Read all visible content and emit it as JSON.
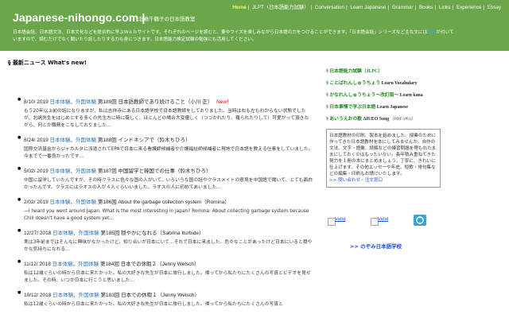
{
  "header": {
    "site_title": "Japanese-nihongo.com",
    "site_title_separator": "|",
    "tagline": "北嶋千鶴子の日本語教室",
    "nav": [
      {
        "label": "Home",
        "active": true
      },
      {
        "label": "JLPT（日本語能力試験）",
        "active": false
      },
      {
        "label": "Conversation",
        "active": false
      },
      {
        "label": "Learn Japanese",
        "active": false
      },
      {
        "label": "Grammar",
        "active": false
      },
      {
        "label": "Books",
        "active": false
      },
      {
        "label": "Links",
        "active": false
      },
      {
        "label": "Experience",
        "active": false
      },
      {
        "label": "Essay",
        "active": false
      }
    ],
    "intro_line1_prefix": "日本語会話、日本語文法、日本文化などを総合的に学ぶWｅｂサイトです。それぞれのページを読むと、要中ウイズを楽しみながら日本語の力をつけることができます。「日本語会話」シリーズなど主な文には",
    "intro_highlight": "読み",
    "intro_line1_suffix": "が付いて",
    "intro_line2": "いますので、読むだけでなく聞いたり話したりする力も身につきます。日本語能力検定試験の勉強にも活用してください。"
  },
  "news": {
    "heading": "§ 最新ニュース What's new!",
    "items": [
      {
        "date": "8/10/ 2019",
        "tag1": "日本体験",
        "tag2": "外国体験",
        "title": "第189回 日本語教師であり続けること（小川 正）",
        "new": "New！",
        "body": "もう20年以上前の話になりますが、私は吉祥寺にある日本語学校で日本語教師をしておりました。当時は右も左もわからない状態でしたが、北嶋先生をはじめとする多くの先生方に時に厳しく、ほとんどの場合大変優しく（つつかれたり、羅られたりして）可愛がって頂きながら、何とか職務をこなしておりました…"
      },
      {
        "date": "6/24/ 2019",
        "tag1": "日本体験",
        "tag2": "外国体験",
        "title": "第188回 インドネシアで（鈴木ちひろ）",
        "new": "",
        "body": "国際交流基金からジャカルタに派遣されてEPAで日本に来る看護師候補者や介護福祉師候補者に現地で日本語を教える仕事をしていました。今までで一番良かったです…"
      },
      {
        "date": "5/02/ 2019",
        "tag1": "日本体験",
        "tag2": "外国体験",
        "title": "第187回 中国留学と韓国での仕事（鈴木ちひろ）",
        "new": "",
        "body": "中国に留学していたんですが、その時クラスに色々な国の人がいて、いろいろな国の話やクラスメイトの意見を中国語で聞いて、とても面白かったんです。クラスにはラオスの人が４人ぐらいいました。ラオスの人に初めてあいました…"
      },
      {
        "date": "2/02/ 2019",
        "tag1": "日本体験",
        "tag2": "外国体験",
        "title": "第186回 About the garbage collection system（Romina）",
        "new": "",
        "body": "―I heard you went around Japan. What is the most interesting in Japan? Romina: About collecting garbage system because Chili doesn't have a good system yet…"
      },
      {
        "date": "12/27/ 2018",
        "tag1": "日本体験",
        "tag2": "外国体験",
        "title": "第185回 穏やかになれる（Sabrina Iturbide）",
        "new": "",
        "body": "実は3年前まではそんなに興味がなかったけど、知り合いが日本にいて…それで日本に来ました。色々なことがあったけど日本にいると穏やかな気持ちになれる…"
      },
      {
        "date": "11/12/ 2018",
        "tag1": "日本体験",
        "tag2": "外国体験",
        "title": "第184回 日本での休暇２（Jenny Welsch）",
        "new": "",
        "body": "私は12歳ぐらいの時から日本に来たかった。私の大好きな先生が日本に旅行しました。帰ってから私たちにたくさんの写真とビデオを見せました。その時、いつか日本に行こうと思いました…"
      },
      {
        "date": "10/12/ 2018",
        "tag1": "日本体験",
        "tag2": "外国体験",
        "title": "第183回 日本での休暇１（Jenny Welsch）",
        "new": "",
        "body": "私は12歳ぐらいの時から日本に来たかった。私の大好きな先生が日本に旅行しました。帰ってから私たちにたくさんの写真と"
      }
    ]
  },
  "sidebar": {
    "links": [
      {
        "jp": "§ 日本語能力試験（JLPC）",
        "en": "",
        "small": ""
      },
      {
        "jp": "§ ことばれんしゅうちょう",
        "en": "Learn Vocabulary",
        "small": ""
      },
      {
        "jp": "§ かなれんしゅうちょう～改訂版～",
        "en": "Learn kana",
        "small": ""
      },
      {
        "jp": "§ 日本事情で学ぶ日本語",
        "en": "Learn Japanese",
        "small": ""
      },
      {
        "jp": "§ あいうえおの歌",
        "en": "AIUEO Song",
        "small": "（PDF 3Ｋb）"
      }
    ],
    "box_text": "日本語教材の印刷、製本を始めました。授業のために作ってきた日本語教材を本にしてみませんか。自作の文法、文字・語彙、読解などの練習問題を埋もれたままにしておくのはもったいない。長年積み重ねてきた努力を１冊の本にまとめましょう。丁寧に、きれいに仕上げます。その他エッセーや年史、短歌・俳句集などの編集・印刷もお請けいたします。",
    "box_link": ">> 問い合わせ・注文窓口",
    "badges": [
      "Valid",
      "Valid",
      ""
    ],
    "school_link": ">> のぞみ日本語学校"
  }
}
